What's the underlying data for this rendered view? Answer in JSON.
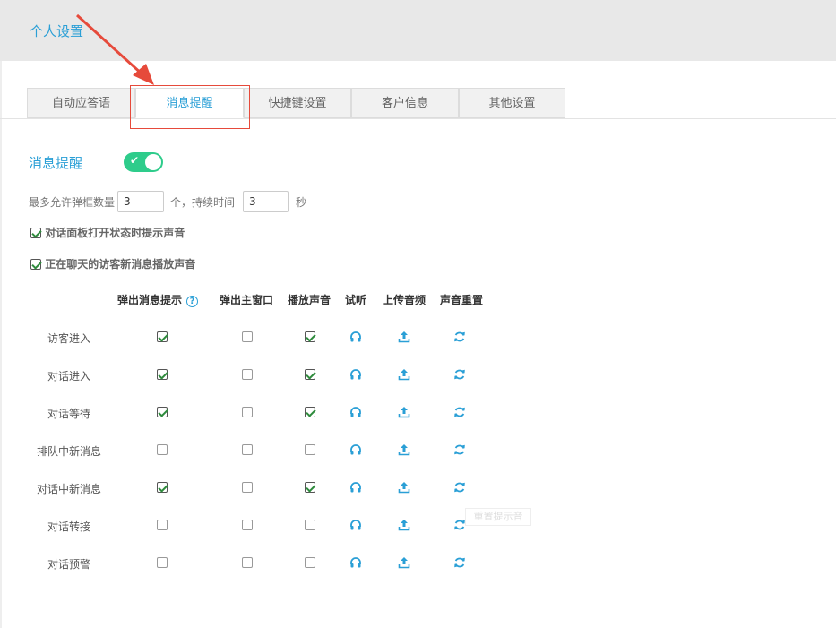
{
  "header": {
    "title": "个人设置"
  },
  "tabs": [
    {
      "label": "自动应答语",
      "active": false
    },
    {
      "label": "消息提醒",
      "active": true
    },
    {
      "label": "快捷键设置",
      "active": false
    },
    {
      "label": "客户信息",
      "active": false
    },
    {
      "label": "其他设置",
      "active": false
    }
  ],
  "section": {
    "title": "消息提醒",
    "enabled": true
  },
  "limits": {
    "max_popup_label": "最多允许弹框数量",
    "max_popup_value": "3",
    "unit_count_label": "个，持续时间",
    "duration_value": "3",
    "unit_seconds": "秒"
  },
  "options": [
    {
      "label": "对话面板打开状态时提示声音",
      "checked": true
    },
    {
      "label": "正在聊天的访客新消息播放声音",
      "checked": true
    }
  ],
  "table": {
    "columns": [
      "弹出消息提示",
      "弹出主窗口",
      "播放声音",
      "试听",
      "上传音频",
      "声音重置"
    ],
    "rows": [
      {
        "label": "访客进入",
        "popup": true,
        "main_window": false,
        "sound": true
      },
      {
        "label": "对话进入",
        "popup": true,
        "main_window": false,
        "sound": true
      },
      {
        "label": "对话等待",
        "popup": true,
        "main_window": false,
        "sound": true
      },
      {
        "label": "排队中新消息",
        "popup": false,
        "main_window": false,
        "sound": false
      },
      {
        "label": "对话中新消息",
        "popup": true,
        "main_window": false,
        "sound": true
      },
      {
        "label": "对话转接",
        "popup": false,
        "main_window": false,
        "sound": false
      },
      {
        "label": "对话预警",
        "popup": false,
        "main_window": false,
        "sound": false
      }
    ]
  },
  "ghost_tooltip": "重置提示音",
  "icons": {
    "listen": "headphones-icon",
    "upload": "upload-icon",
    "reset": "refresh-icon",
    "help": "question-circle-icon"
  },
  "colors": {
    "accent": "#2a9fd6",
    "toggle": "#2ecc8b",
    "annotation": "#e64a3b"
  }
}
